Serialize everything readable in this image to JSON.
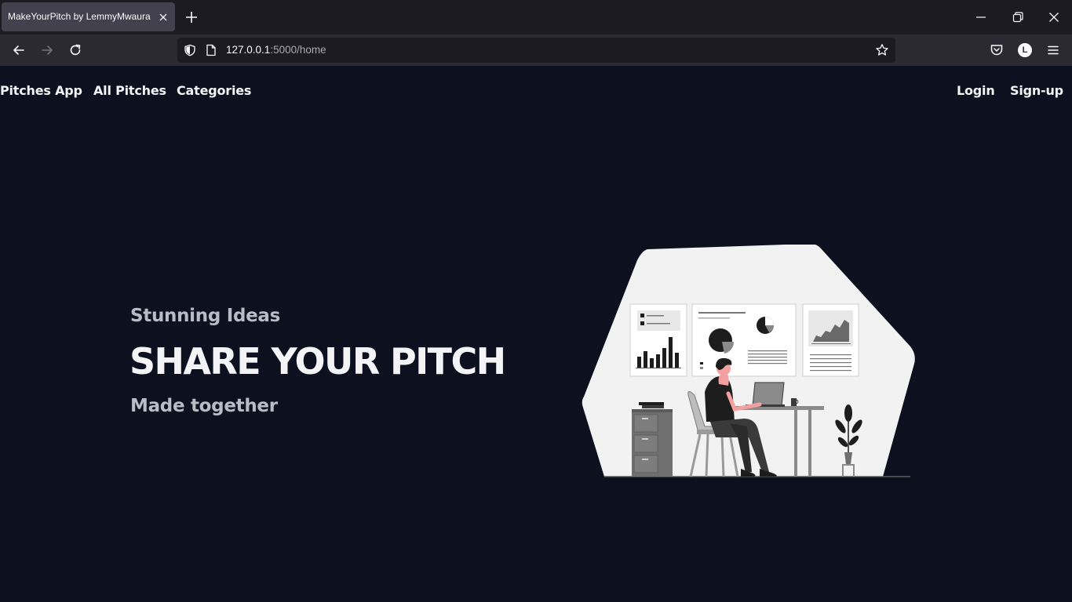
{
  "browser": {
    "tab_title": "MakeYourPitch by LemmyMwaura",
    "url_host": "127.0.0.1",
    "url_path": ":5000/home",
    "account_initial": "L"
  },
  "site_nav": {
    "brand": "Pitches App",
    "all_pitches": "All Pitches",
    "categories": "Categories",
    "login": "Login",
    "signup": "Sign-up"
  },
  "hero": {
    "eyebrow": "Stunning Ideas",
    "title": "SHARE YOUR PITCH",
    "subtitle": "Made together"
  },
  "colors": {
    "page_background": "#0c101f",
    "heading_white": "#f4f4f6",
    "muted_gray": "#b9bcc4"
  },
  "icons": {
    "back": "arrow-left-icon",
    "forward": "arrow-right-icon",
    "reload": "reload-icon",
    "bookmark": "star-icon",
    "pocket": "pocket-icon",
    "menu": "hamburger-menu-icon"
  }
}
